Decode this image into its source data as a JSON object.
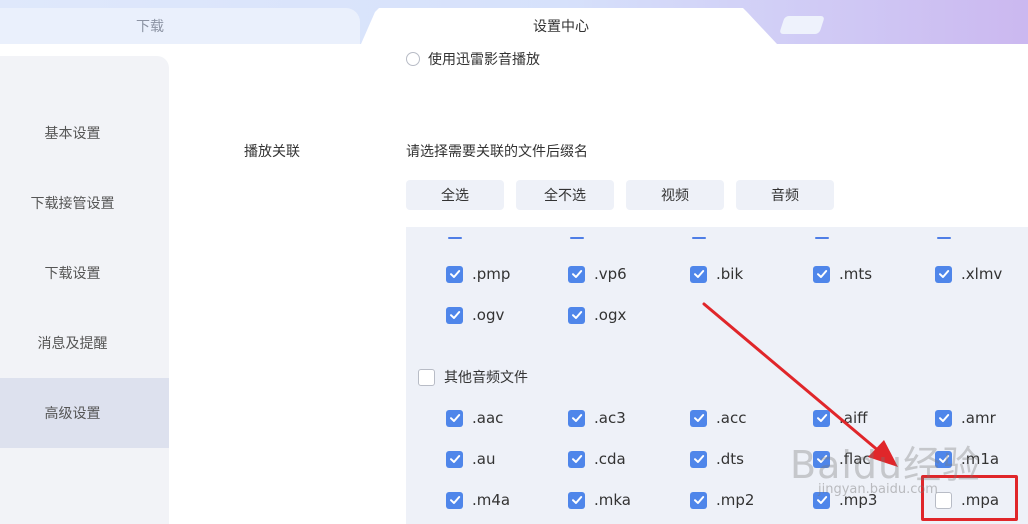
{
  "tabs": {
    "download_label": "下载",
    "settings_label": "设置中心"
  },
  "sidebar": {
    "items": [
      {
        "label": "基本设置"
      },
      {
        "label": "下载接管设置"
      },
      {
        "label": "下载设置"
      },
      {
        "label": "消息及提醒"
      },
      {
        "label": "高级设置"
      }
    ]
  },
  "main": {
    "radio_label": "使用迅雷影音播放",
    "assoc_label": "播放关联",
    "hint": "请选择需要关联的文件后缀名",
    "buttons": {
      "select_all": "全选",
      "select_none": "全不选",
      "video": "视频",
      "audio": "音频"
    },
    "video_rows": [
      [
        ".pmp",
        ".vp6",
        ".bik",
        ".mts",
        ".xlmv"
      ],
      [
        ".ogv",
        ".ogx"
      ]
    ],
    "audio_group_title": "其他音频文件",
    "audio_rows": [
      [
        ".aac",
        ".ac3",
        ".acc",
        ".aiff",
        ".amr"
      ],
      [
        ".au",
        ".cda",
        ".dts",
        ".flac",
        ".m1a"
      ],
      [
        ".m4a",
        ".mka",
        ".mp2",
        ".mp3",
        ".mpa"
      ]
    ]
  },
  "watermark": {
    "text": "Baidu经验",
    "sub": "jingyan.baidu.com"
  },
  "colors": {
    "accent": "#4f86ea",
    "highlight": "#e0262a"
  }
}
